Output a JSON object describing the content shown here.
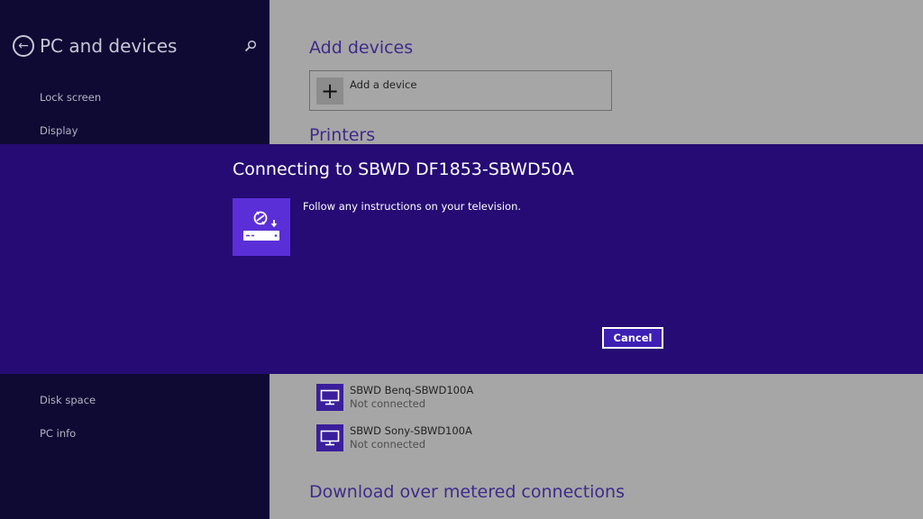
{
  "sidebar": {
    "title": "PC and devices",
    "items": [
      {
        "label": "Lock screen"
      },
      {
        "label": "Display"
      },
      {
        "label": "Disk space"
      },
      {
        "label": "PC info"
      }
    ]
  },
  "main": {
    "add_devices_title": "Add devices",
    "add_device_label": "Add a device",
    "printers_title": "Printers",
    "devices": [
      {
        "name": "SBWD Benq-SBWD100A",
        "status": "Not connected"
      },
      {
        "name": "SBWD Sony-SBWD100A",
        "status": "Not connected"
      }
    ],
    "metered_title": "Download over metered connections"
  },
  "dialog": {
    "title": "Connecting to SBWD DF1853-SBWD50A",
    "message": "Follow any instructions on your television.",
    "cancel_label": "Cancel"
  },
  "colors": {
    "sidebar_bg": "#0e0a33",
    "main_bg": "#a6a6a6",
    "dialog_bg": "#250b73",
    "accent": "#3f2a8a",
    "tile": "#5b2fd8"
  }
}
